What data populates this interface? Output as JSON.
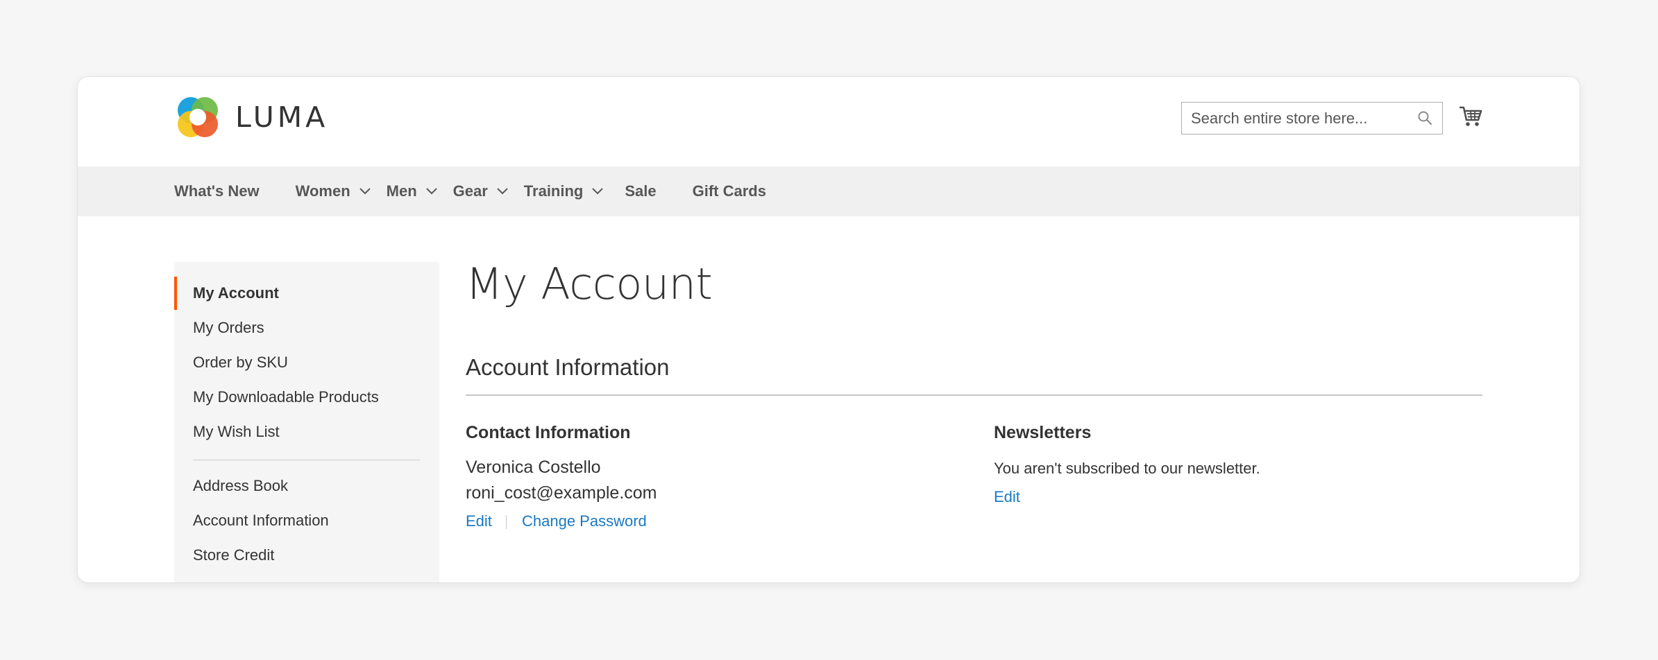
{
  "brand": {
    "name": "LUMA"
  },
  "search": {
    "placeholder": "Search entire store here..."
  },
  "nav": {
    "items": [
      {
        "label": "What's New",
        "has_dropdown": false
      },
      {
        "label": "Women",
        "has_dropdown": true
      },
      {
        "label": "Men",
        "has_dropdown": true
      },
      {
        "label": "Gear",
        "has_dropdown": true
      },
      {
        "label": "Training",
        "has_dropdown": true
      },
      {
        "label": "Sale",
        "has_dropdown": false
      },
      {
        "label": "Gift Cards",
        "has_dropdown": false
      }
    ]
  },
  "sidebar": {
    "items": [
      {
        "label": "My Account",
        "active": true
      },
      {
        "label": "My Orders"
      },
      {
        "label": "Order by SKU"
      },
      {
        "label": "My Downloadable Products"
      },
      {
        "label": "My Wish List"
      },
      {
        "label": "Address Book"
      },
      {
        "label": "Account Information"
      },
      {
        "label": "Store Credit"
      }
    ]
  },
  "main": {
    "page_title": "My Account",
    "section_title": "Account Information",
    "contact": {
      "title": "Contact Information",
      "name": "Veronica Costello",
      "email": "roni_cost@example.com",
      "edit_label": "Edit",
      "change_password_label": "Change Password"
    },
    "newsletters": {
      "title": "Newsletters",
      "status": "You aren't subscribed to our newsletter.",
      "edit_label": "Edit"
    }
  },
  "colors": {
    "accent": "#ff5501",
    "link": "#1979c3",
    "nav_bg": "#f0f0f0",
    "sidebar_bg": "#f5f5f5"
  },
  "icons": {
    "search": "search-icon",
    "cart": "cart-icon",
    "chevron": "chevron-down-icon"
  }
}
